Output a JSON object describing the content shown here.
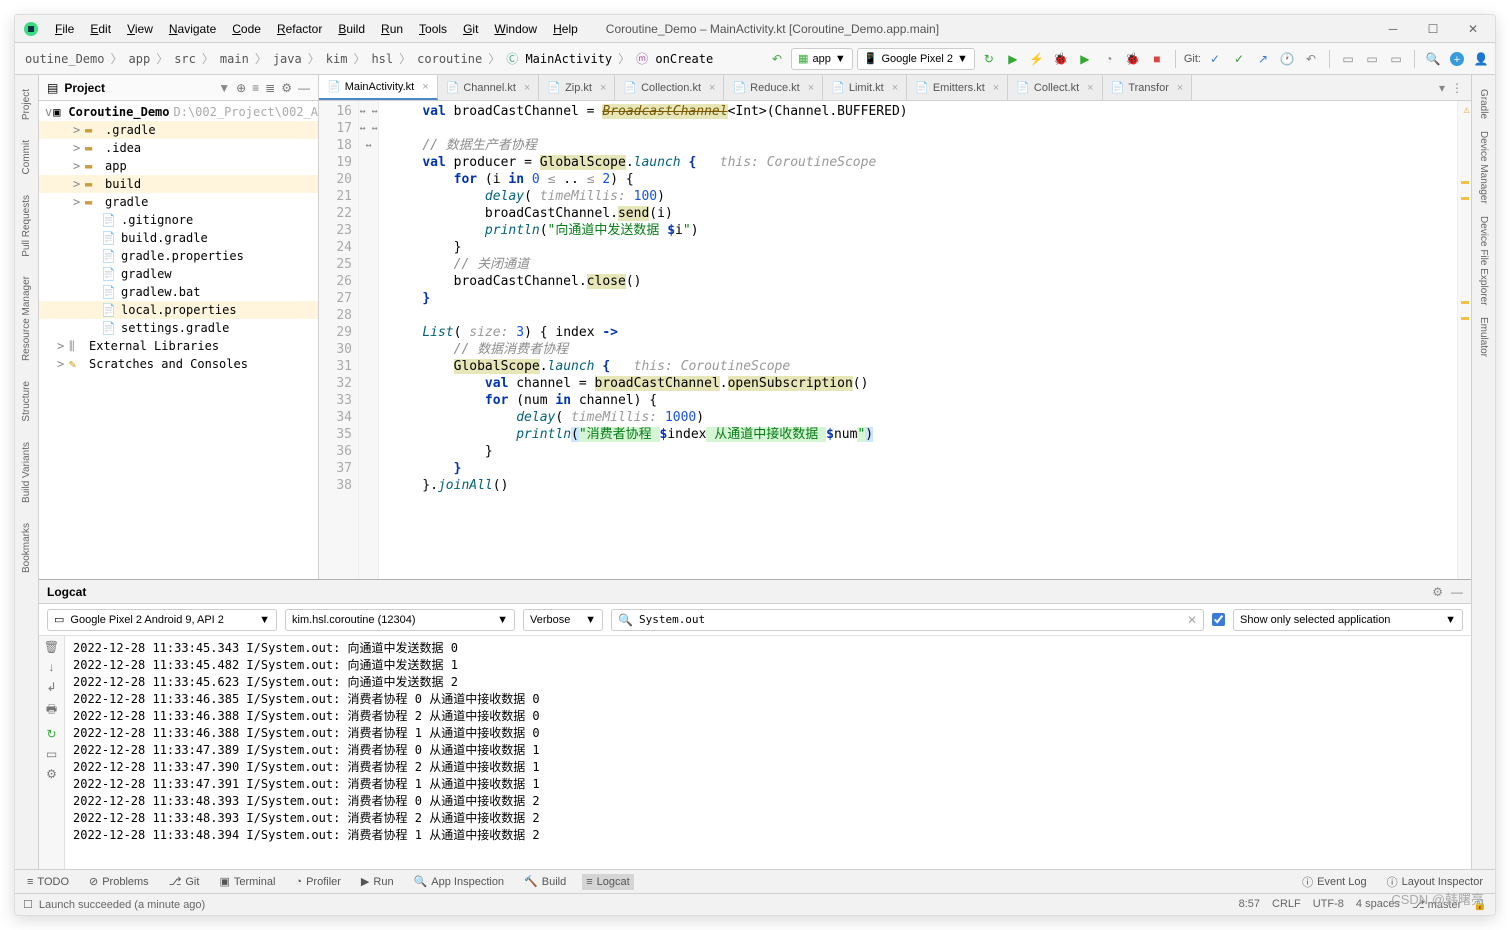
{
  "window": {
    "title": "Coroutine_Demo – MainActivity.kt [Coroutine_Demo.app.main]",
    "menus": [
      "File",
      "Edit",
      "View",
      "Navigate",
      "Code",
      "Refactor",
      "Build",
      "Run",
      "Tools",
      "Git",
      "Window",
      "Help"
    ]
  },
  "breadcrumb": [
    "outine_Demo",
    "app",
    "src",
    "main",
    "java",
    "kim",
    "hsl",
    "coroutine",
    "MainActivity",
    "onCreate"
  ],
  "toolbar": {
    "run_config": "app",
    "device": "Google Pixel 2",
    "git_label": "Git:"
  },
  "project_panel": {
    "title": "Project",
    "root": {
      "name": "Coroutine_Demo",
      "path": "D:\\002_Project\\002_A"
    },
    "items": [
      {
        "depth": 1,
        "name": ".gradle",
        "type": "folder",
        "arrow": ">",
        "selected": true
      },
      {
        "depth": 1,
        "name": ".idea",
        "type": "folder",
        "arrow": ">"
      },
      {
        "depth": 1,
        "name": "app",
        "type": "folder",
        "arrow": ">"
      },
      {
        "depth": 1,
        "name": "build",
        "type": "folder",
        "arrow": ">",
        "selected": true
      },
      {
        "depth": 1,
        "name": "gradle",
        "type": "folder",
        "arrow": ">"
      },
      {
        "depth": 2,
        "name": ".gitignore",
        "type": "file"
      },
      {
        "depth": 2,
        "name": "build.gradle",
        "type": "file"
      },
      {
        "depth": 2,
        "name": "gradle.properties",
        "type": "file"
      },
      {
        "depth": 2,
        "name": "gradlew",
        "type": "file"
      },
      {
        "depth": 2,
        "name": "gradlew.bat",
        "type": "file"
      },
      {
        "depth": 2,
        "name": "local.properties",
        "type": "file",
        "selected": true
      },
      {
        "depth": 2,
        "name": "settings.gradle",
        "type": "file"
      },
      {
        "depth": 0,
        "name": "External Libraries",
        "type": "lib",
        "arrow": ">"
      },
      {
        "depth": 0,
        "name": "Scratches and Consoles",
        "type": "scratch",
        "arrow": ">"
      }
    ]
  },
  "editor_tabs": [
    {
      "name": "MainActivity.kt",
      "active": true
    },
    {
      "name": "Channel.kt"
    },
    {
      "name": "Zip.kt"
    },
    {
      "name": "Collection.kt"
    },
    {
      "name": "Reduce.kt"
    },
    {
      "name": "Limit.kt"
    },
    {
      "name": "Emitters.kt"
    },
    {
      "name": "Collect.kt"
    },
    {
      "name": "Transfor"
    }
  ],
  "editor": {
    "line_start": 16,
    "line_end": 38,
    "marks": {
      "22": "↔",
      "23": "↔",
      "34": "↔",
      "35": "↔",
      "38": "↔"
    }
  },
  "logcat": {
    "title": "Logcat",
    "device": "Google Pixel 2 Android 9, API 2",
    "process": "kim.hsl.coroutine (12304)",
    "level": "Verbose",
    "search": "System.out",
    "filter_label": "Show only selected application",
    "lines": [
      "2022-12-28 11:33:45.343 I/System.out: 向通道中发送数据 0",
      "2022-12-28 11:33:45.482 I/System.out: 向通道中发送数据 1",
      "2022-12-28 11:33:45.623 I/System.out: 向通道中发送数据 2",
      "2022-12-28 11:33:46.385 I/System.out: 消费者协程 0 从通道中接收数据 0",
      "2022-12-28 11:33:46.388 I/System.out: 消费者协程 2 从通道中接收数据 0",
      "2022-12-28 11:33:46.388 I/System.out: 消费者协程 1 从通道中接收数据 0",
      "2022-12-28 11:33:47.389 I/System.out: 消费者协程 0 从通道中接收数据 1",
      "2022-12-28 11:33:47.390 I/System.out: 消费者协程 2 从通道中接收数据 1",
      "2022-12-28 11:33:47.391 I/System.out: 消费者协程 1 从通道中接收数据 1",
      "2022-12-28 11:33:48.393 I/System.out: 消费者协程 0 从通道中接收数据 2",
      "2022-12-28 11:33:48.393 I/System.out: 消费者协程 2 从通道中接收数据 2",
      "2022-12-28 11:33:48.394 I/System.out: 消费者协程 1 从通道中接收数据 2"
    ]
  },
  "bottom_tools": {
    "items": [
      "TODO",
      "Problems",
      "Git",
      "Terminal",
      "Profiler",
      "Run",
      "App Inspection",
      "Build",
      "Logcat"
    ],
    "active": "Logcat",
    "right": [
      "Event Log",
      "Layout Inspector"
    ]
  },
  "statusbar": {
    "message": "Launch succeeded (a minute ago)",
    "pos": "8:57",
    "eol": "CRLF",
    "enc": "UTF-8",
    "indent": "4 spaces",
    "branch": "master"
  },
  "watermark": "CSDN @韩曙亮"
}
